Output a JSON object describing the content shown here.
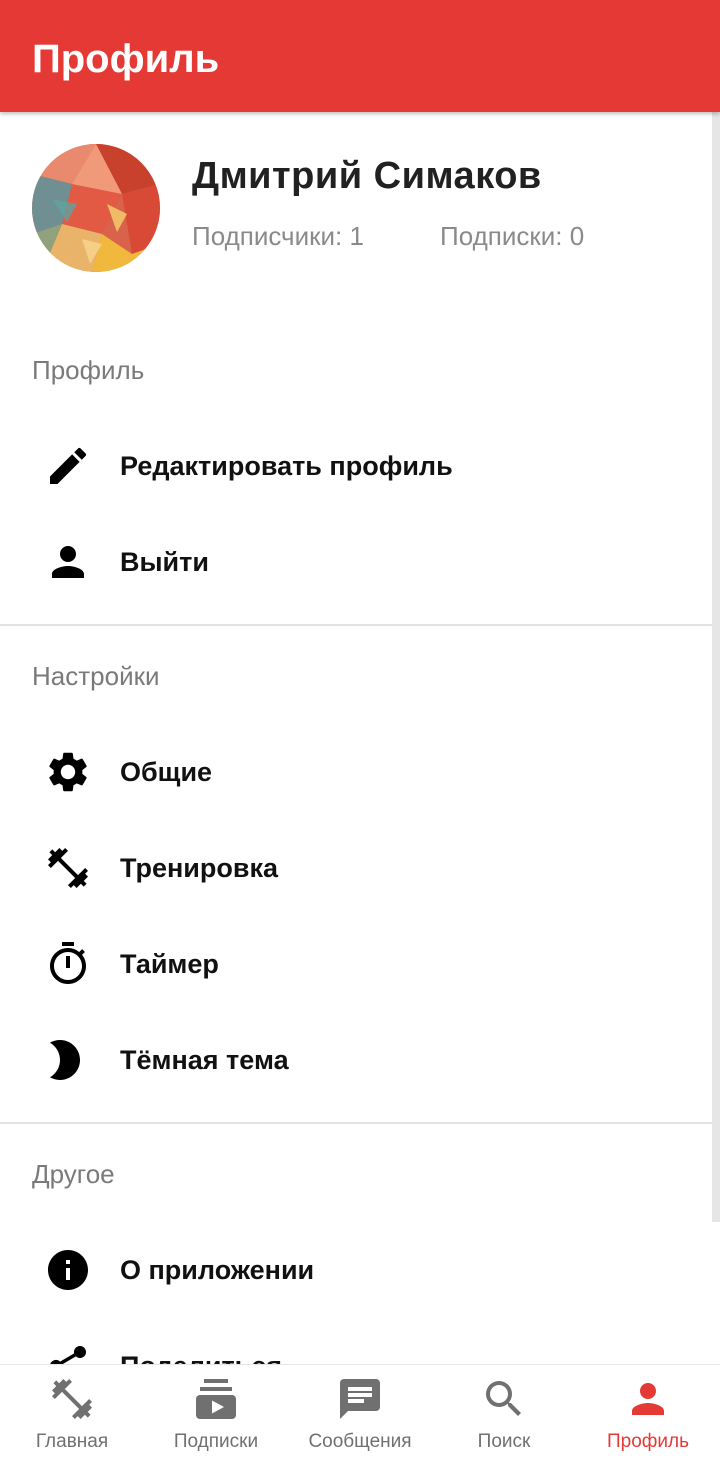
{
  "app_bar": {
    "title": "Профиль"
  },
  "profile": {
    "name": "Дмитрий Симаков",
    "followers": "Подписчики: 1",
    "following": "Подписки: 0"
  },
  "sections": {
    "profile": {
      "title": "Профиль",
      "items": [
        {
          "label": "Редактировать профиль",
          "icon": "pencil-icon"
        },
        {
          "label": "Выйти",
          "icon": "person-icon"
        }
      ]
    },
    "settings": {
      "title": "Настройки",
      "items": [
        {
          "label": "Общие",
          "icon": "gear-icon"
        },
        {
          "label": "Тренировка",
          "icon": "dumbbell-icon"
        },
        {
          "label": "Таймер",
          "icon": "stopwatch-icon"
        },
        {
          "label": "Тёмная тема",
          "icon": "moon-icon"
        }
      ]
    },
    "other": {
      "title": "Другое",
      "items": [
        {
          "label": "О приложении",
          "icon": "info-icon"
        },
        {
          "label": "Поделиться",
          "icon": "share-icon"
        }
      ]
    }
  },
  "bottom_nav": {
    "items": [
      {
        "label": "Главная",
        "icon": "dumbbell-icon",
        "active": false
      },
      {
        "label": "Подписки",
        "icon": "subscriptions-icon",
        "active": false
      },
      {
        "label": "Сообщения",
        "icon": "chat-icon",
        "active": false
      },
      {
        "label": "Поиск",
        "icon": "search-icon",
        "active": false
      },
      {
        "label": "Профиль",
        "icon": "person-icon",
        "active": true
      }
    ]
  },
  "colors": {
    "accent": "#e53935",
    "inactive_nav": "#707070",
    "section_title": "#7a7a7a",
    "divider": "#e2e2e2"
  }
}
